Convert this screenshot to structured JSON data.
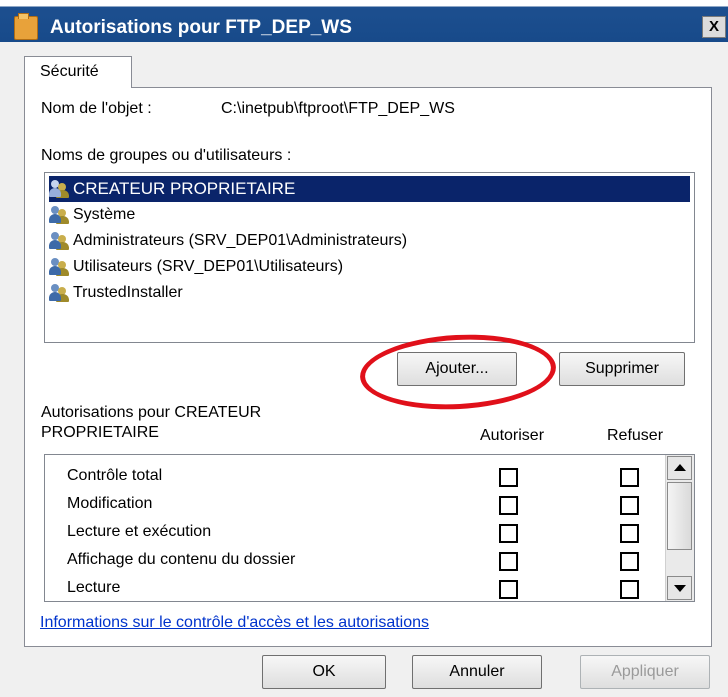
{
  "window": {
    "title": "Autorisations pour FTP_DEP_WS",
    "close_label": "X"
  },
  "tabs": [
    {
      "label": "Sécurité"
    }
  ],
  "security": {
    "object_label": "Nom de l'objet :",
    "object_path": "C:\\inetpub\\ftproot\\FTP_DEP_WS",
    "groups_label": "Noms de groupes ou d'utilisateurs :",
    "groups": [
      {
        "name": "CREATEUR PROPRIETAIRE",
        "selected": true
      },
      {
        "name": "Système",
        "selected": false
      },
      {
        "name": "Administrateurs (SRV_DEP01\\Administrateurs)",
        "selected": false
      },
      {
        "name": "Utilisateurs (SRV_DEP01\\Utilisateurs)",
        "selected": false
      },
      {
        "name": "TrustedInstaller",
        "selected": false
      }
    ],
    "add_button": "Ajouter...",
    "remove_button": "Supprimer",
    "permissions_for_label_line1": "Autorisations pour CREATEUR",
    "permissions_for_label_line2": "PROPRIETAIRE",
    "allow_header": "Autoriser",
    "deny_header": "Refuser",
    "permissions": [
      {
        "name": "Contrôle total",
        "allow": false,
        "deny": false
      },
      {
        "name": "Modification",
        "allow": false,
        "deny": false
      },
      {
        "name": "Lecture et exécution",
        "allow": false,
        "deny": false
      },
      {
        "name": "Affichage du contenu du dossier",
        "allow": false,
        "deny": false
      },
      {
        "name": "Lecture",
        "allow": false,
        "deny": false
      }
    ],
    "info_link": "Informations sur le contrôle d'accès et les autorisations"
  },
  "footer": {
    "ok_label": "OK",
    "cancel_label": "Annuler",
    "apply_label": "Appliquer"
  },
  "colors": {
    "titlebar": "#174a8a",
    "selection": "#0a246a",
    "annotation_circle": "#e0101a",
    "link": "#0033cc"
  }
}
